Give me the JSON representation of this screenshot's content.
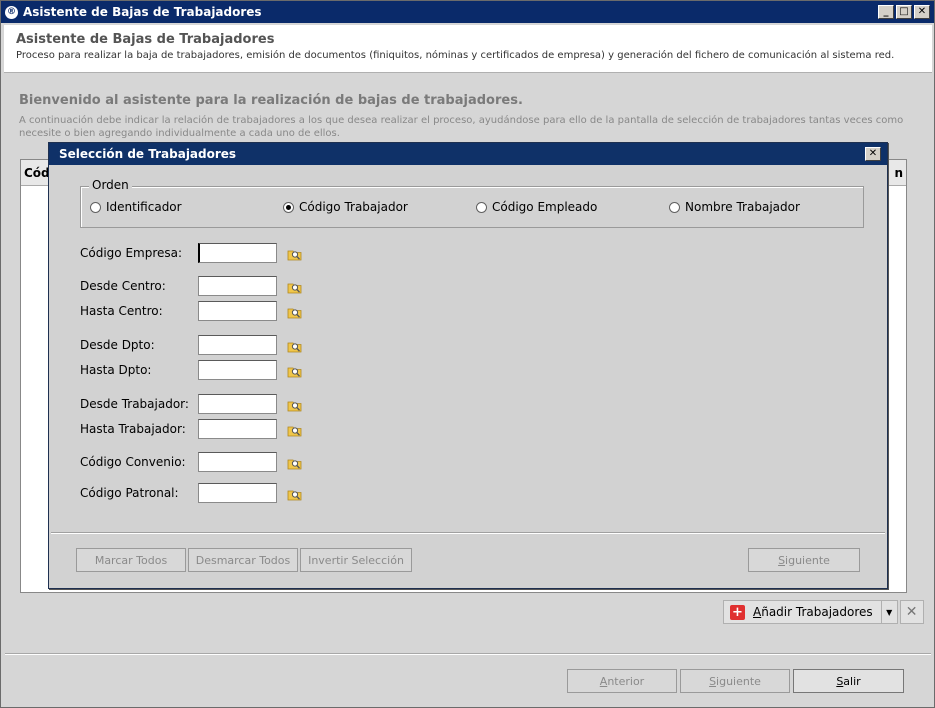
{
  "window": {
    "title": "Asistente de Bajas de Trabajadores"
  },
  "header": {
    "title": "Asistente de Bajas de Trabajadores",
    "subtitle": "Proceso para realizar la baja de trabajadores, emisión de documentos (finiquitos, nóminas y certificados de empresa) y generación del fichero de comunicación al sistema red."
  },
  "main": {
    "welcome": "Bienvenido al asistente para la realización de bajas de trabajadores.",
    "intro": "A continuación debe indicar la relación de trabajadores a los que desea realizar el proceso, ayudándose para ello de la pantalla de selección de trabajadores tantas veces como necesite o bien agregando individualmente a cada uno de ellos.",
    "grid_col_first": "Códi",
    "grid_col_last": "n"
  },
  "toolbar": {
    "add_workers_prefix": "",
    "add_workers_hotkey": "A",
    "add_workers_rest": "ñadir Trabajadores"
  },
  "footer": {
    "back_hotkey": "A",
    "back_rest": "nterior",
    "next_hotkey": "S",
    "next_rest": "iguiente",
    "exit_hotkey": "S",
    "exit_rest": "alir"
  },
  "dialog": {
    "title": "Selección de Trabajadores",
    "order_label": "Orden",
    "order_options": [
      "Identificador",
      "Código Trabajador",
      "Código Empleado",
      "Nombre Trabajador"
    ],
    "order_selected": "Código Trabajador",
    "fields": [
      {
        "label": "Código Empresa:",
        "value": ""
      },
      {
        "label": "Desde Centro:",
        "value": ""
      },
      {
        "label": "Hasta Centro:",
        "value": ""
      },
      {
        "label": "Desde Dpto:",
        "value": ""
      },
      {
        "label": "Hasta Dpto:",
        "value": ""
      },
      {
        "label": "Desde Trabajador:",
        "value": ""
      },
      {
        "label": "Hasta Trabajador:",
        "value": ""
      },
      {
        "label": "Código Convenio:",
        "value": ""
      },
      {
        "label": "Código Patronal:",
        "value": ""
      }
    ],
    "buttons": {
      "mark_all": "Marcar Todos",
      "unmark_all": "Desmarcar Todos",
      "invert": "Invertir Selección",
      "next_hotkey": "S",
      "next_rest": "iguiente"
    }
  },
  "colors": {
    "title_bar": "#0a2a6a",
    "dialog_title_bar": "#0f3168",
    "add_icon": "#e03030"
  }
}
